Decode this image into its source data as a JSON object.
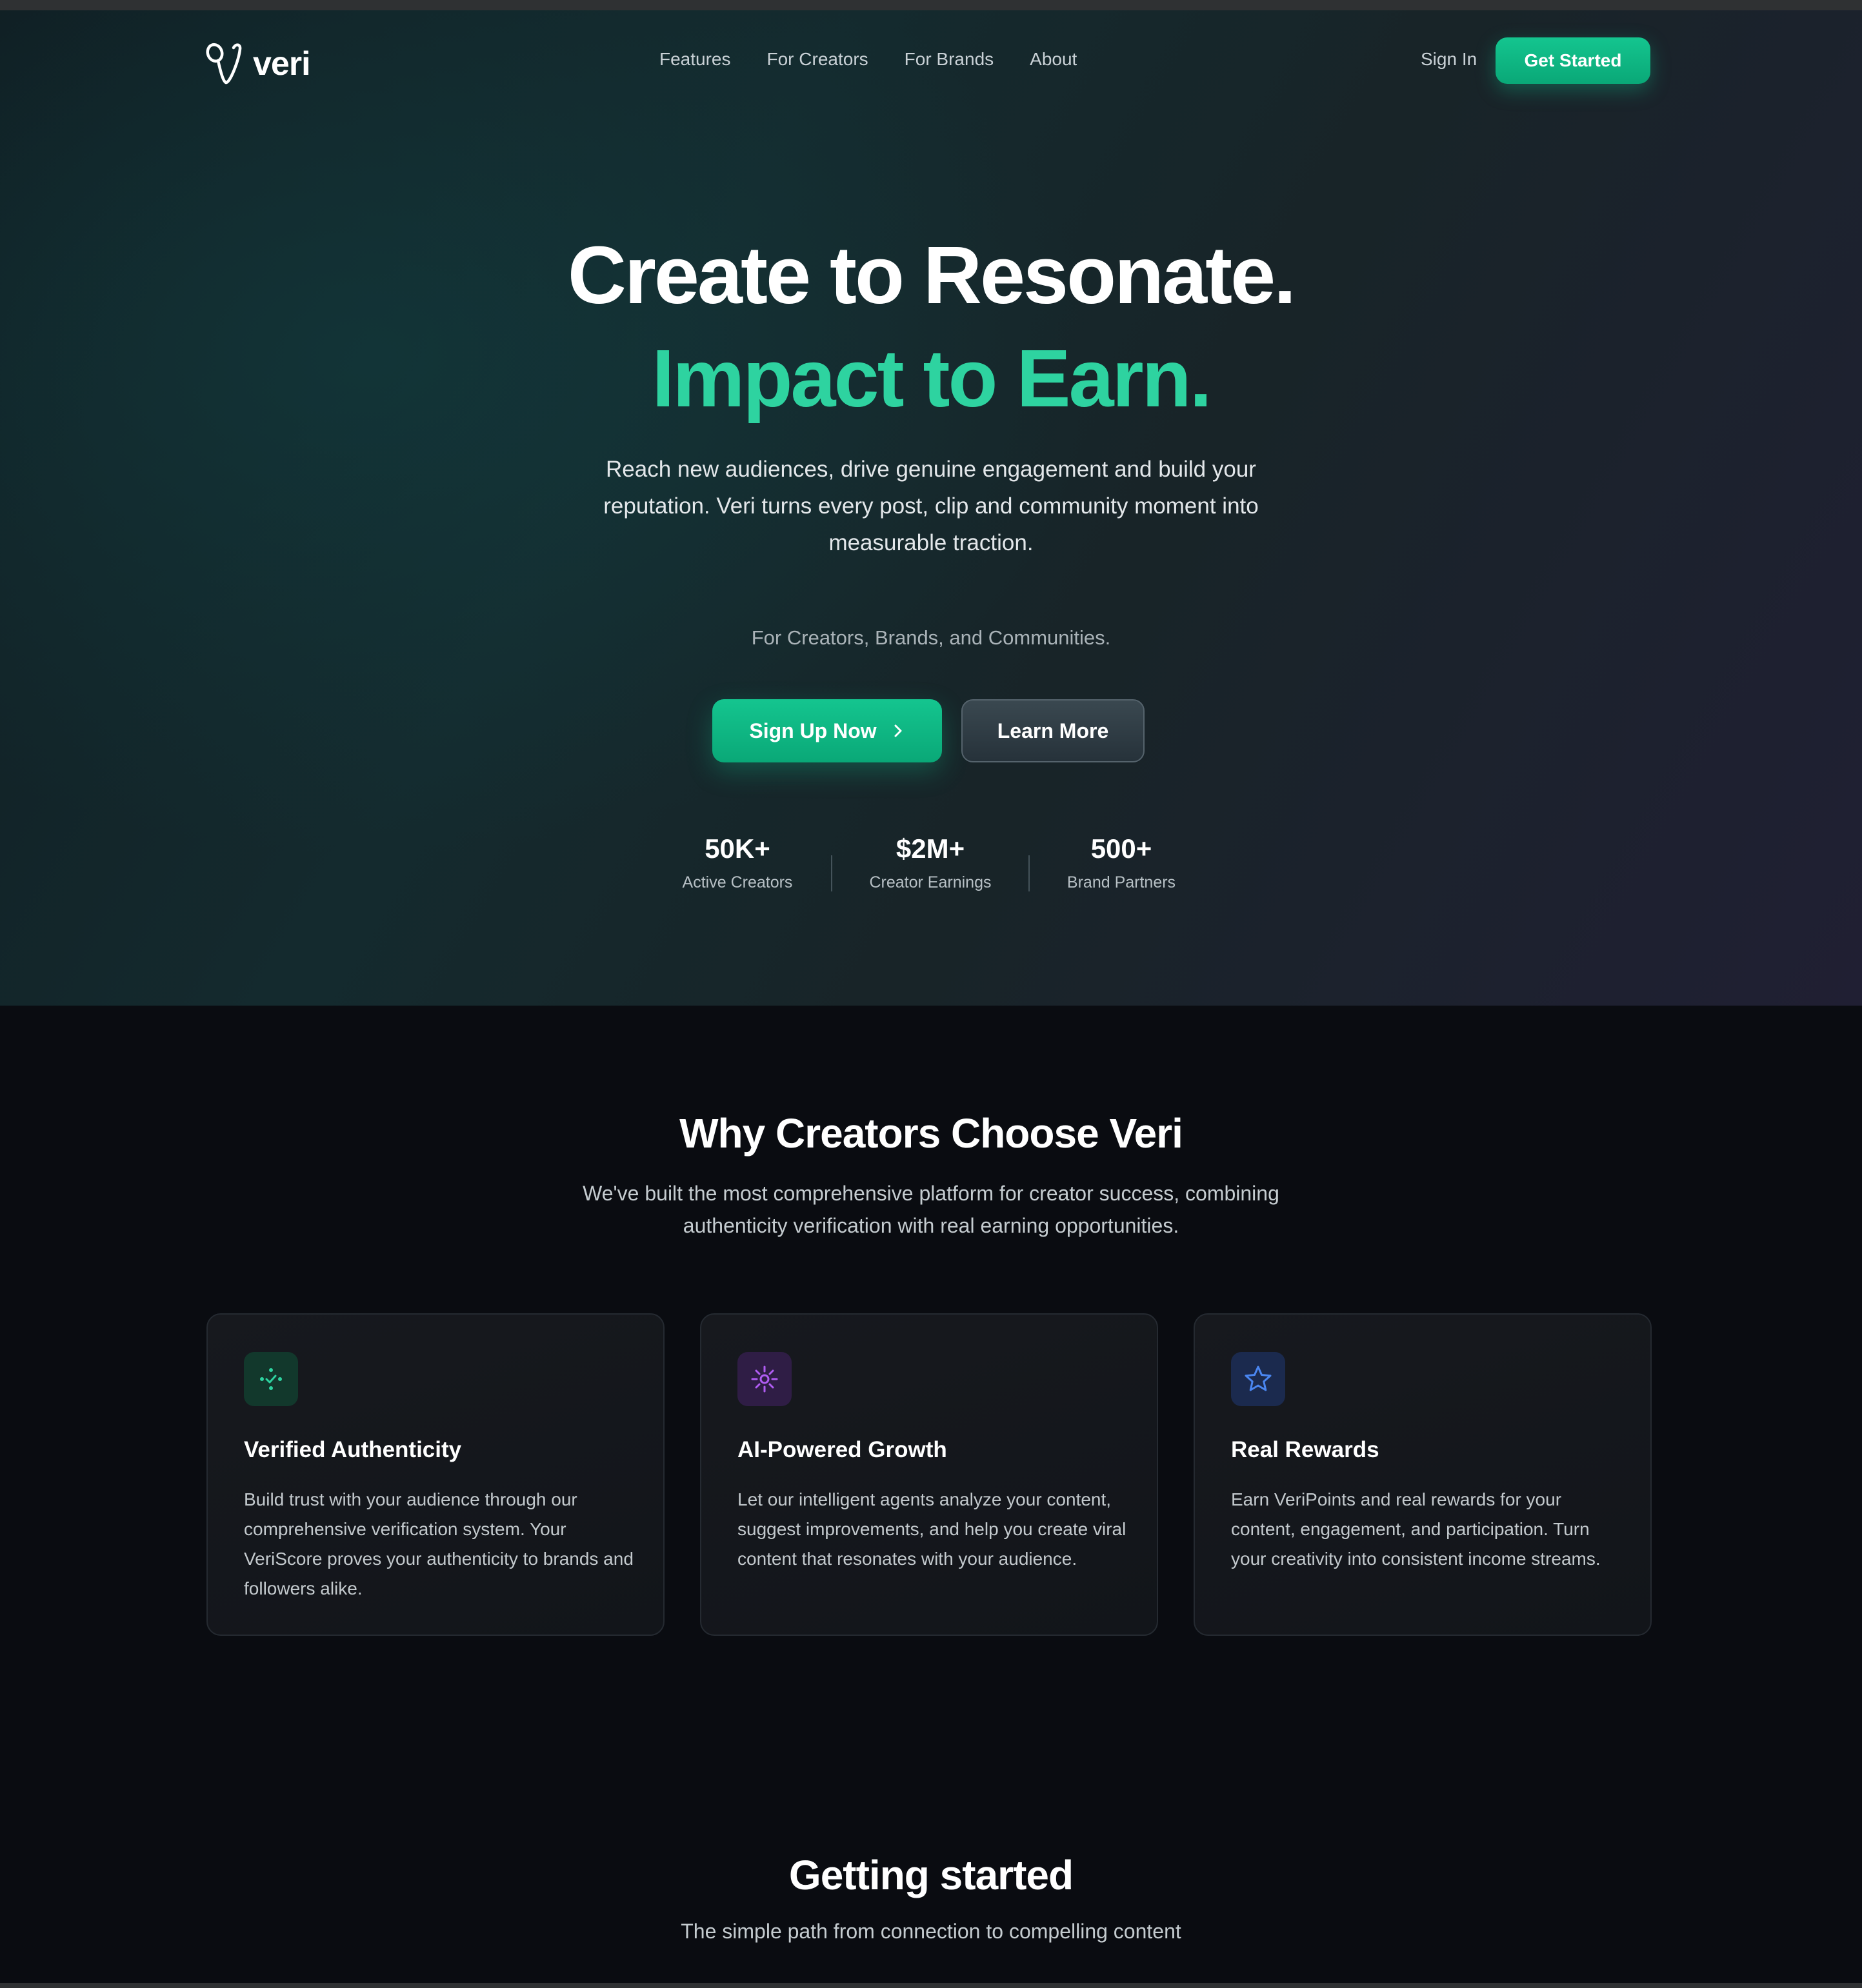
{
  "nav": {
    "brand": "veri",
    "links": [
      "Features",
      "For Creators",
      "For Brands",
      "About"
    ],
    "sign_in": "Sign In",
    "get_started": "Get Started"
  },
  "hero": {
    "title_line1": "Create to Resonate.",
    "title_line2": "Impact to Earn.",
    "description": "Reach new audiences, drive genuine engagement and build your reputation. Veri turns every post, clip and community moment into measurable traction.",
    "audience": "For Creators, Brands, and Communities.",
    "primary_cta": "Sign Up Now",
    "secondary_cta": "Learn More",
    "stats": [
      {
        "value": "50K+",
        "label": "Active Creators"
      },
      {
        "value": "$2M+",
        "label": "Creator Earnings"
      },
      {
        "value": "500+",
        "label": "Brand Partners"
      }
    ]
  },
  "why": {
    "title": "Why Creators Choose Veri",
    "subtitle": "We've built the most comprehensive platform for creator success, combining authenticity verification with real earning opportunities.",
    "cards": [
      {
        "icon": "verified-sparkle-icon",
        "title": "Verified Authenticity",
        "text": "Build trust with your audience through our comprehensive verification system. Your VeriScore proves your authenticity to brands and followers alike."
      },
      {
        "icon": "sun-sparkle-icon",
        "title": "AI-Powered Growth",
        "text": "Let our intelligent agents analyze your content, suggest improvements, and help you create viral content that resonates with your audience."
      },
      {
        "icon": "star-icon",
        "title": "Real Rewards",
        "text": "Earn VeriPoints and real rewards for your content, engagement, and participation. Turn your creativity into consistent income streams."
      }
    ]
  },
  "getting_started": {
    "title": "Getting started",
    "subtitle": "The simple path from connection to compelling content"
  },
  "colors": {
    "accent_green": "#2ed3a0",
    "button_green": "#0fb683",
    "icon_purple": "#b05cf2",
    "icon_blue": "#4a86f0",
    "page_bg": "#0a0c11"
  }
}
